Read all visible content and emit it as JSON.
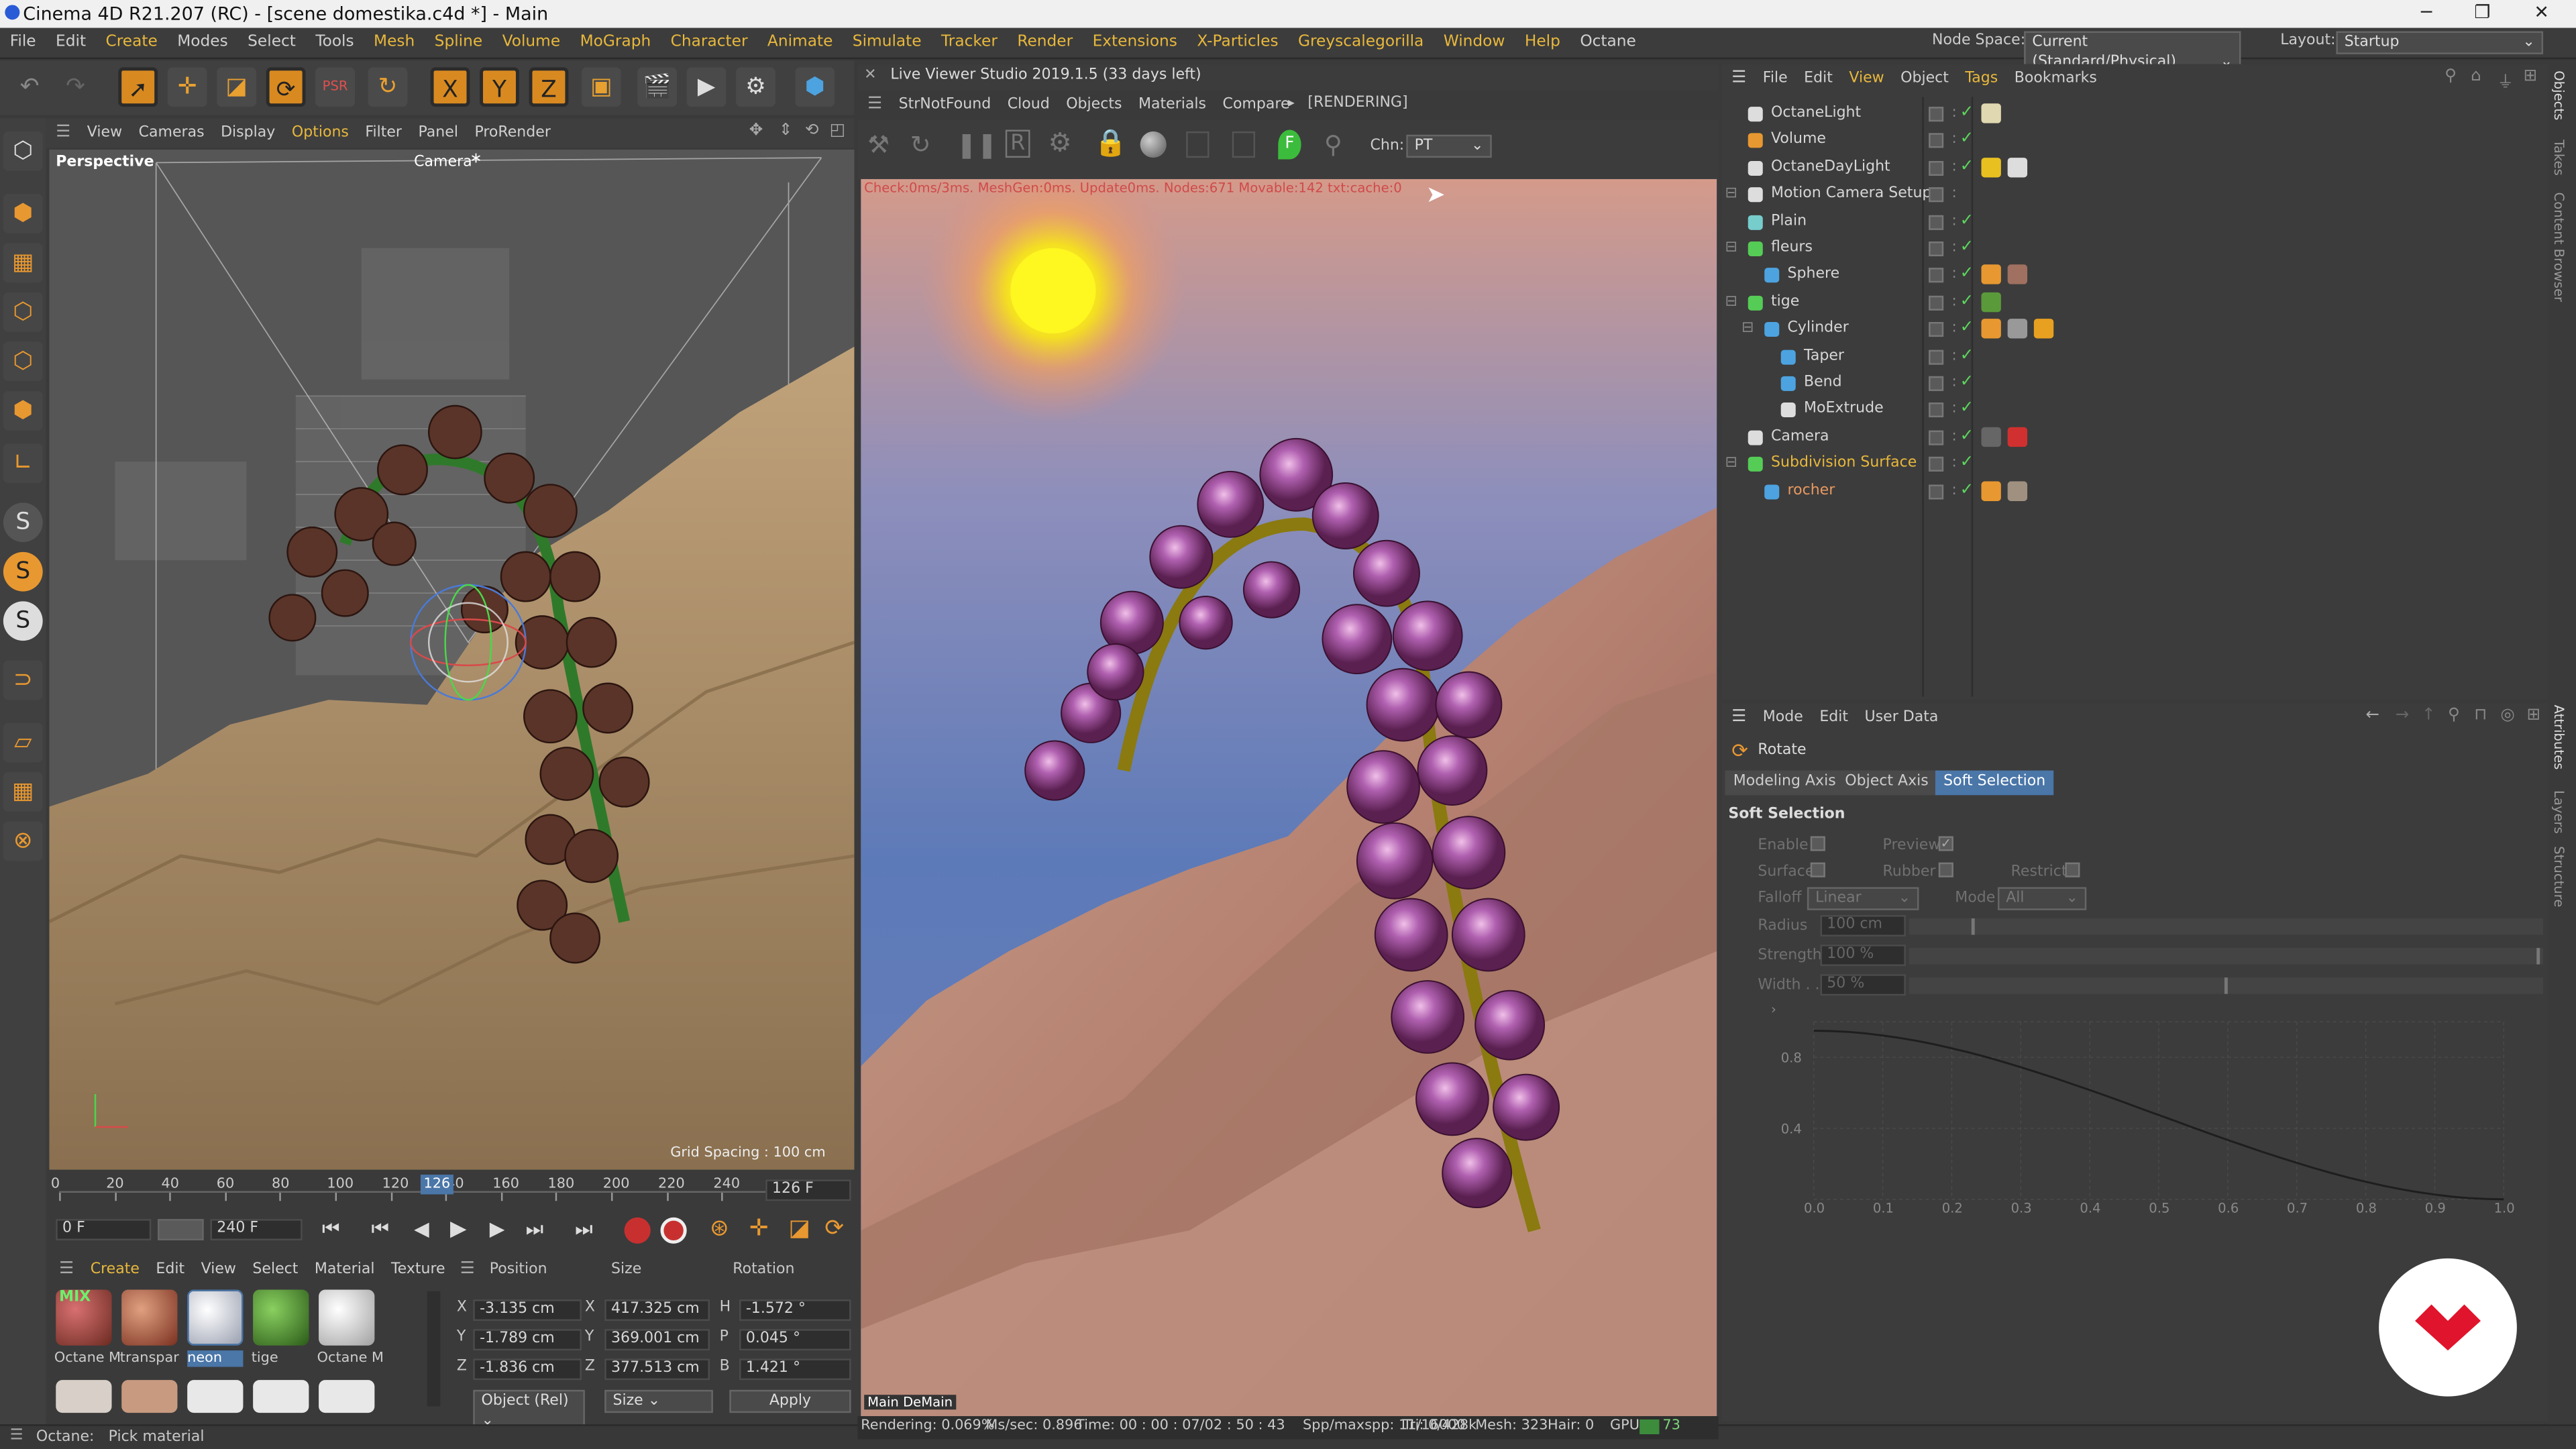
{
  "title": "Cinema 4D R21.207 (RC) - [scene domestika.c4d *] - Main",
  "window_controls": {
    "minimize": "─",
    "maximize": "❐",
    "close": "✕"
  },
  "menu": [
    "File",
    "Edit",
    "Create",
    "Modes",
    "Select",
    "Tools",
    "Mesh",
    "Spline",
    "Volume",
    "MoGraph",
    "Character",
    "Animate",
    "Simulate",
    "Tracker",
    "Render",
    "Extensions",
    "X-Particles",
    "Greyscalegorilla",
    "Window",
    "Help",
    "Octane"
  ],
  "nodespace": {
    "label": "Node Space:",
    "value": "Current (Standard/Physical)"
  },
  "layout": {
    "label": "Layout:",
    "value": "Startup"
  },
  "toolbar_icons": [
    "undo-icon",
    "redo-icon",
    "select-icon",
    "move-icon",
    "scale-icon",
    "rotate-icon",
    "psr-icon",
    "recent-icon",
    "x-axis-icon",
    "y-axis-icon",
    "z-axis-icon",
    "coordinate-system-icon",
    "render-view-icon",
    "render-picture-viewer-icon",
    "render-settings-icon",
    "cube-icon"
  ],
  "viewport": {
    "menu": [
      "View",
      "Cameras",
      "Display",
      "Options",
      "Filter",
      "Panel",
      "ProRender"
    ],
    "label": "Perspective",
    "camera": "Camera",
    "grid": "Grid Spacing : 100 cm"
  },
  "timeline": {
    "ticks": [
      "0",
      "20",
      "40",
      "60",
      "80",
      "100",
      "120",
      "140",
      "160",
      "180",
      "200",
      "220",
      "240"
    ],
    "playhead": "126",
    "frame": "126 F"
  },
  "transport": {
    "start": "0 F",
    "end": "240 F"
  },
  "materials": {
    "menu": [
      "Create",
      "Edit",
      "View",
      "Select",
      "Material",
      "Texture"
    ],
    "items": [
      "Octane M",
      "transpar",
      "neon",
      "tige",
      "Octane M"
    ]
  },
  "coords": {
    "headers": [
      "Position",
      "Size",
      "Rotation"
    ],
    "rows": [
      {
        "a": "X",
        "pos": "-3.135 cm",
        "b": "X",
        "size": "417.325 cm",
        "c": "H",
        "rot": "-1.572 °"
      },
      {
        "a": "Y",
        "pos": "-1.789 cm",
        "b": "Y",
        "size": "369.001 cm",
        "c": "P",
        "rot": "0.045 °"
      },
      {
        "a": "Z",
        "pos": "-1.836 cm",
        "b": "Z",
        "size": "377.513 cm",
        "c": "B",
        "rot": "1.421 °"
      }
    ],
    "mode": "Object (Rel)",
    "sizemode": "Size",
    "apply": "Apply"
  },
  "status": {
    "left": "Octane:",
    "msg": "Pick material"
  },
  "liveviewer": {
    "title": "Live Viewer Studio 2019.1.5 (33 days left)",
    "menu": [
      "StrNotFound",
      "Cloud",
      "Objects",
      "Materials",
      "Compare"
    ],
    "state": "[RENDERING]",
    "chn_label": "Chn:",
    "chn": "PT",
    "overlay": "Check:0ms/3ms. MeshGen:0ms. Update0ms. Nodes:671 Movable:142 txt:cache:0",
    "bottom": {
      "rendering": "Rendering: 0.069%",
      "ms": "Ms/sec: 0.896",
      "time": "Time: 00 : 00 : 07/02 : 50 : 43",
      "spp": "Spp/maxspp: 11/16000",
      "tri": "Tri: 0/428k",
      "mesh": "Mesh: 323",
      "hair": "Hair: 0",
      "gpu": "GPU:",
      "gpuval": "73"
    },
    "tag": "Main DeMain"
  },
  "objmgr": {
    "menu": [
      "File",
      "Edit",
      "View",
      "Object",
      "Tags",
      "Bookmarks"
    ],
    "objects": [
      "OctaneLight",
      "Volume",
      "OctaneDayLight",
      "Motion Camera Setup",
      "Plain",
      "fleurs",
      "Sphere",
      "tige",
      "Cylinder",
      "Taper",
      "Bend",
      "MoExtrude",
      "Camera",
      "Subdivision Surface",
      "rocher"
    ]
  },
  "attr": {
    "menu": [
      "Mode",
      "Edit",
      "User Data"
    ],
    "object": "Rotate",
    "tabs": [
      "Modeling Axis",
      "Object Axis",
      "Soft Selection"
    ],
    "section": "Soft Selection",
    "enable": "Enable",
    "preview": "Preview",
    "surface": "Surface",
    "rubber": "Rubber",
    "restrict": "Restrict",
    "falloff_label": "Falloff",
    "falloff": "Linear",
    "mode_label": "Mode",
    "mode": "All",
    "radius_label": "Radius",
    "radius": "100 cm",
    "strength_label": "Strength",
    "strength": "100 %",
    "width_label": "Width . .",
    "width": "50 %",
    "curve_y": [
      "0.8",
      "0.4"
    ],
    "curve_x": [
      "0.0",
      "0.1",
      "0.2",
      "0.3",
      "0.4",
      "0.5",
      "0.6",
      "0.7",
      "0.8",
      "0.9",
      "1.0"
    ]
  },
  "rightstrip": [
    "Objects",
    "Takes",
    "Content Browser",
    "Attributes",
    "Layers",
    "Structure"
  ]
}
